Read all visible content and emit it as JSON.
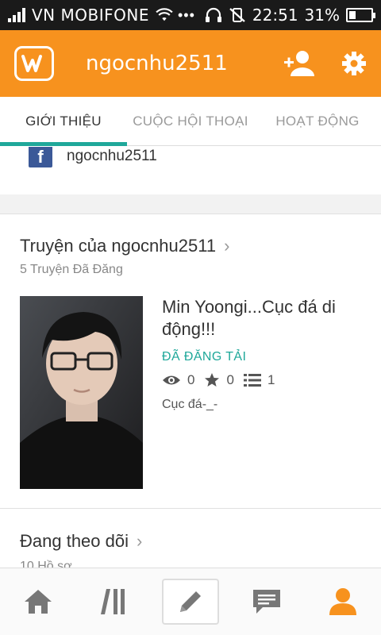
{
  "status_bar": {
    "carrier": "VN MOBIFONE",
    "dots": "•••",
    "time": "22:51",
    "battery_text": "31%",
    "battery_level": 0.31
  },
  "app_bar": {
    "logo_letter": "W",
    "title": "ngocnhu2511",
    "icons": [
      "add-user-icon",
      "gear-icon"
    ],
    "color": "#f7921e"
  },
  "tabs": [
    {
      "label": "GIỚI THIỆU",
      "active": true
    },
    {
      "label": "CUỘC HỘI THOẠI",
      "active": false
    },
    {
      "label": "HOẠT ĐỘNG",
      "active": false
    }
  ],
  "about": {
    "facebook_letter": "f",
    "facebook_name": "ngocnhu2511"
  },
  "stories_section": {
    "title": "Truyện của ngocnhu2511",
    "chevron": "›",
    "subtitle": "5 Truyện Đã Đăng",
    "story": {
      "title": "Min Yoongi...Cục đá di động!!!",
      "status": "ĐÃ ĐĂNG TẢI",
      "views": "0",
      "votes": "0",
      "parts": "1",
      "description": "Cục đá-_-"
    }
  },
  "following_section": {
    "title": "Đang theo dõi",
    "chevron": "›",
    "subtitle": "10 Hồ sơ"
  },
  "bottom_nav": [
    "home-icon",
    "library-icon",
    "write-icon",
    "messages-icon",
    "profile-icon"
  ],
  "colors": {
    "accent": "#f7921e",
    "teal": "#1fa89a",
    "facebook": "#3b5998"
  }
}
